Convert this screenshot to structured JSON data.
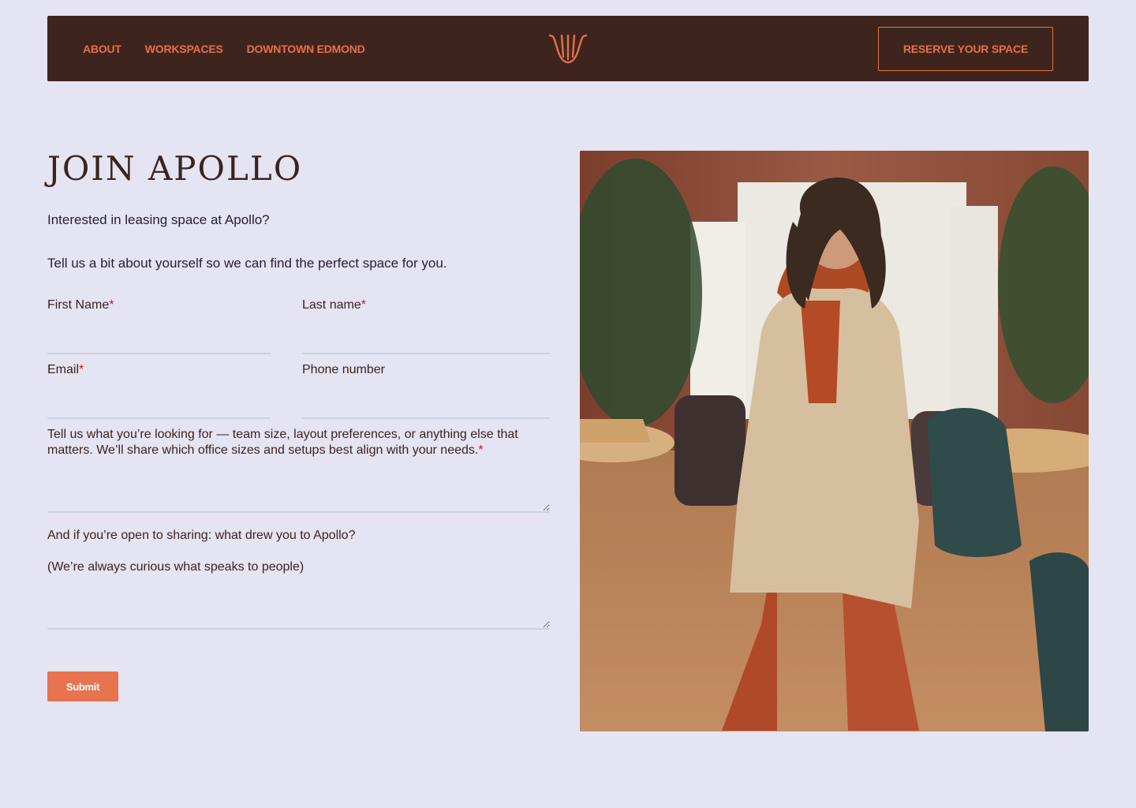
{
  "nav": {
    "links": [
      "ABOUT",
      "WORKSPACES",
      "DOWNTOWN EDMOND"
    ],
    "reserve_label": "RESERVE YOUR SPACE",
    "logo_icon": "lyre-logo-icon",
    "accent": "#e86f48",
    "bg": "#3d251e"
  },
  "page": {
    "title": "JOIN APOLLO",
    "intro_1": "Interested in leasing space at Apollo?",
    "intro_2": "Tell us a bit about yourself so we can find the perfect space for you."
  },
  "form": {
    "first_name_label": "First Name",
    "last_name_label": "Last name",
    "email_label": "Email",
    "phone_label": "Phone number",
    "needs_label": "Tell us what you’re looking for — team size, layout preferences, or anything else that matters. We’ll share which office sizes and setups best align with your needs.",
    "drew_label_1": "And if you’re open to sharing: what drew you to Apollo?",
    "drew_label_2": "(We’re always curious what speaks to people)",
    "required_mark": "*",
    "submit_label": "Submit"
  },
  "photo": {
    "icon": "woman-in-cafe-photo"
  },
  "colors": {
    "background": "#e4e4f2",
    "submit": "#e8734f",
    "required": "#d3121b"
  }
}
